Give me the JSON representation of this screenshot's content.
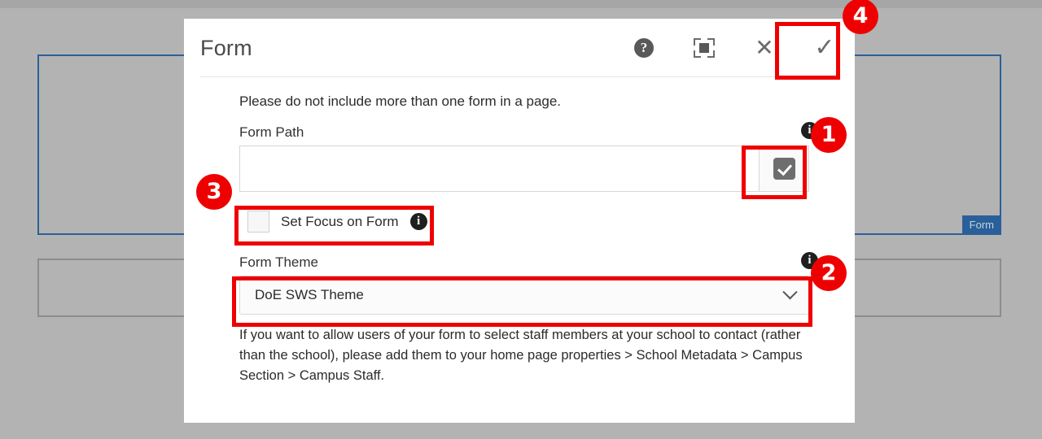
{
  "background": {
    "component_form_tag": "Form"
  },
  "dialog": {
    "title": "Form",
    "header_actions": [
      {
        "name": "help",
        "icon": "help-circle-icon",
        "glyph": "?"
      },
      {
        "name": "fullscreen",
        "icon": "fullscreen-icon"
      },
      {
        "name": "close",
        "icon": "close-x-icon",
        "glyph": "✕"
      },
      {
        "name": "confirm",
        "icon": "checkmark-icon",
        "glyph": "✓"
      }
    ],
    "intro_note": "Please do not include more than one form in a page.",
    "form_path": {
      "label": "Form Path",
      "value": "",
      "placeholder": "",
      "info_glyph": "i",
      "picker_icon": "checkbox-checked-icon"
    },
    "set_focus": {
      "label": "Set Focus on Form",
      "checked": false,
      "info_glyph": "i"
    },
    "form_theme": {
      "label": "Form Theme",
      "selected": "DoE SWS Theme",
      "info_glyph": "i",
      "caret_icon": "chevron-down-icon"
    },
    "footer_note": "If you want to allow users of your form to select staff members at your school to contact (rather than the school), please add them to your home page properties > School Metadata > Campus Section > Campus Staff."
  },
  "annotations": {
    "accent_color": "#ef0000",
    "badges": [
      {
        "id": "1",
        "label": "1",
        "targets": "form-path-picker-button"
      },
      {
        "id": "2",
        "label": "2",
        "targets": "form-theme-select"
      },
      {
        "id": "3",
        "label": "3",
        "targets": "set-focus-on-form-row"
      },
      {
        "id": "4",
        "label": "4",
        "targets": "confirm-button"
      }
    ]
  }
}
